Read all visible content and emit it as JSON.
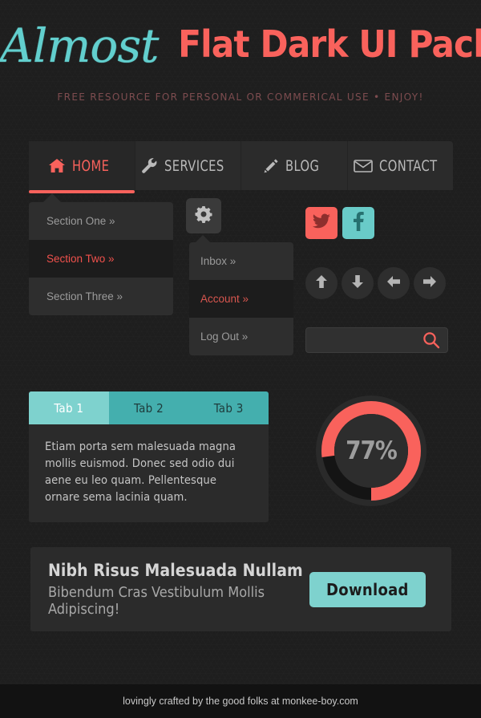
{
  "header": {
    "logo_script": "Almost",
    "logo_bold": "Flat Dark UI Pack",
    "tagline": "FREE RESOURCE FOR PERSONAL OR COMMERICAL USE  •   ENJOY!"
  },
  "nav": {
    "items": [
      {
        "label": "HOME",
        "icon": "home-icon",
        "active": true
      },
      {
        "label": "SERVICES",
        "icon": "wrench-icon",
        "active": false
      },
      {
        "label": "BLOG",
        "icon": "pencil-icon",
        "active": false
      },
      {
        "label": "CONTACT",
        "icon": "envelope-icon",
        "active": false
      }
    ]
  },
  "sections": {
    "items": [
      {
        "label": "Section One »",
        "active": false
      },
      {
        "label": "Section Two »",
        "active": true
      },
      {
        "label": "Section Three »",
        "active": false
      }
    ]
  },
  "gear": {
    "icon": "gear-icon"
  },
  "dropdown": {
    "items": [
      {
        "label": "Inbox »",
        "active": false
      },
      {
        "label": "Account »",
        "active": true
      },
      {
        "label": "Log Out »",
        "active": false
      }
    ]
  },
  "social": {
    "buttons": [
      {
        "name": "twitter",
        "icon": "twitter-icon",
        "color": "#f9625c"
      },
      {
        "name": "facebook",
        "icon": "facebook-icon",
        "color": "#69cbc8"
      }
    ]
  },
  "arrows": {
    "buttons": [
      {
        "icon": "arrow-up-icon"
      },
      {
        "icon": "arrow-down-icon"
      },
      {
        "icon": "arrow-left-icon"
      },
      {
        "icon": "arrow-right-icon"
      }
    ]
  },
  "search": {
    "value": "",
    "placeholder": "",
    "icon": "search-icon"
  },
  "tabs": {
    "items": [
      {
        "label": "Tab 1",
        "active": true
      },
      {
        "label": "Tab 2",
        "active": false
      },
      {
        "label": "Tab 3",
        "active": false
      }
    ],
    "panel_text": "Etiam porta sem malesuada magna mollis euismod. Donec sed odio dui aene eu leo quam. Pellentesque ornare sema lacinia quam."
  },
  "progress": {
    "label": "77%",
    "percent": 77,
    "track_color": "#1c1c1c",
    "fill_color": "#f9625c"
  },
  "banner": {
    "title": "Nibh Risus Malesuada Nullam",
    "subtitle": "Bibendum Cras Vestibulum Mollis Adipiscing!",
    "button_label": "Download"
  },
  "footer": {
    "text": "lovingly crafted by the good folks at monkee-boy.com"
  },
  "colors": {
    "accent_coral": "#f9625c",
    "accent_teal": "#7ed2ce",
    "teal_dark": "#44afae",
    "page_bg": "#1f1f1f",
    "panel_bg": "#2b2b2b"
  }
}
